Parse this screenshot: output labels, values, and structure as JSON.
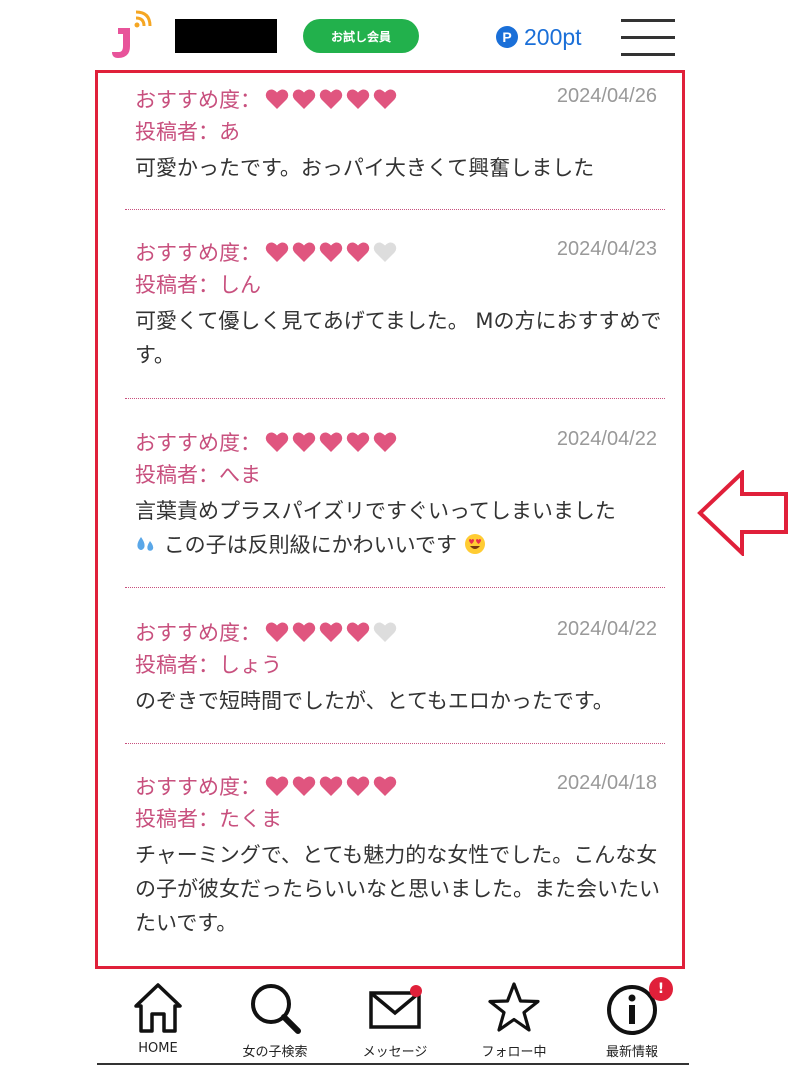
{
  "header": {
    "badge_label": "お試し会員",
    "points_icon": "P",
    "points_value": "200pt"
  },
  "reviews": [
    {
      "rating_label": "おすすめ度：",
      "rating": 5,
      "date": "2024/04/26",
      "author": "投稿者：あ",
      "body": "可愛かったです。おっパイ大きくて興奮しました"
    },
    {
      "rating_label": "おすすめ度：",
      "rating": 4,
      "date": "2024/04/23",
      "author": "投稿者：しん",
      "body": "可愛くて優しく見てあげてました。 Mの方におすすめです。"
    },
    {
      "rating_label": "おすすめ度：",
      "rating": 5,
      "date": "2024/04/22",
      "author": "投稿者：へま",
      "body_line1": "言葉責めプラスパイズリですぐいってしまいました",
      "body_line2": "この子は反則級にかわいいです"
    },
    {
      "rating_label": "おすすめ度：",
      "rating": 4,
      "date": "2024/04/22",
      "author": "投稿者：しょう",
      "body": "のぞきで短時間でしたが、とてもエロかったです。"
    },
    {
      "rating_label": "おすすめ度：",
      "rating": 5,
      "date": "2024/04/18",
      "author": "投稿者：たくま",
      "body": "チャーミングで、とても魅力的な女性でした。こんな女の子が彼女だったらいいなと思いました。また会いたいたいです。"
    }
  ],
  "nav": {
    "home": "HOME",
    "search": "女の子検索",
    "message": "メッセージ",
    "follow": "フォロー中",
    "news": "最新情報",
    "news_badge": "!"
  },
  "colors": {
    "accent_pink": "#c8507e",
    "heart_filled": "#e0557f",
    "heart_empty": "#dddddd",
    "border_red": "#e0203a",
    "trial_green": "#22b14c",
    "points_blue": "#1a6fd8"
  },
  "icons": [
    "logo-icon",
    "points-icon",
    "hamburger-menu-icon",
    "heart-icon",
    "sweat-drops-emoji",
    "heart-eyes-emoji",
    "left-arrow-icon",
    "home-icon",
    "search-icon",
    "mail-icon",
    "star-icon",
    "info-icon"
  ]
}
